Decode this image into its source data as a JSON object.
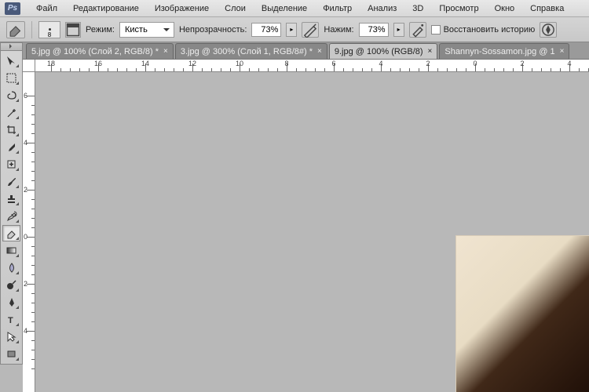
{
  "app": {
    "logo": "Ps"
  },
  "menu": [
    "Файл",
    "Редактирование",
    "Изображение",
    "Слои",
    "Выделение",
    "Фильтр",
    "Анализ",
    "3D",
    "Просмотр",
    "Окно",
    "Справка"
  ],
  "options": {
    "brush_size": "8",
    "mode_label": "Режим:",
    "mode_value": "Кисть",
    "opacity_label": "Непрозрачность:",
    "opacity_value": "73%",
    "flow_label": "Нажим:",
    "flow_value": "73%",
    "history_label": "Восстановить историю"
  },
  "tabs": [
    {
      "label": "5.jpg @ 100% (Слой 2, RGB/8) *",
      "active": false
    },
    {
      "label": "3.jpg @ 300% (Слой 1, RGB/8#) *",
      "active": false
    },
    {
      "label": "9.jpg @ 100% (RGB/8)",
      "active": true
    },
    {
      "label": "Shannyn-Sossamon.jpg @ 1",
      "active": false
    }
  ],
  "ruler_h": [
    "18",
    "16",
    "14",
    "12",
    "10",
    "8",
    "6",
    "4",
    "2",
    "0",
    "2",
    "4"
  ],
  "ruler_v": [
    "6",
    "4",
    "2",
    "0",
    "2",
    "4"
  ],
  "tools": [
    "move",
    "marquee",
    "lasso",
    "wand",
    "crop",
    "eyedropper",
    "healing",
    "brush",
    "stamp",
    "history-brush",
    "eraser",
    "gradient",
    "blur",
    "dodge",
    "pen",
    "type",
    "path-select",
    "rectangle"
  ],
  "active_tool_index": 10
}
